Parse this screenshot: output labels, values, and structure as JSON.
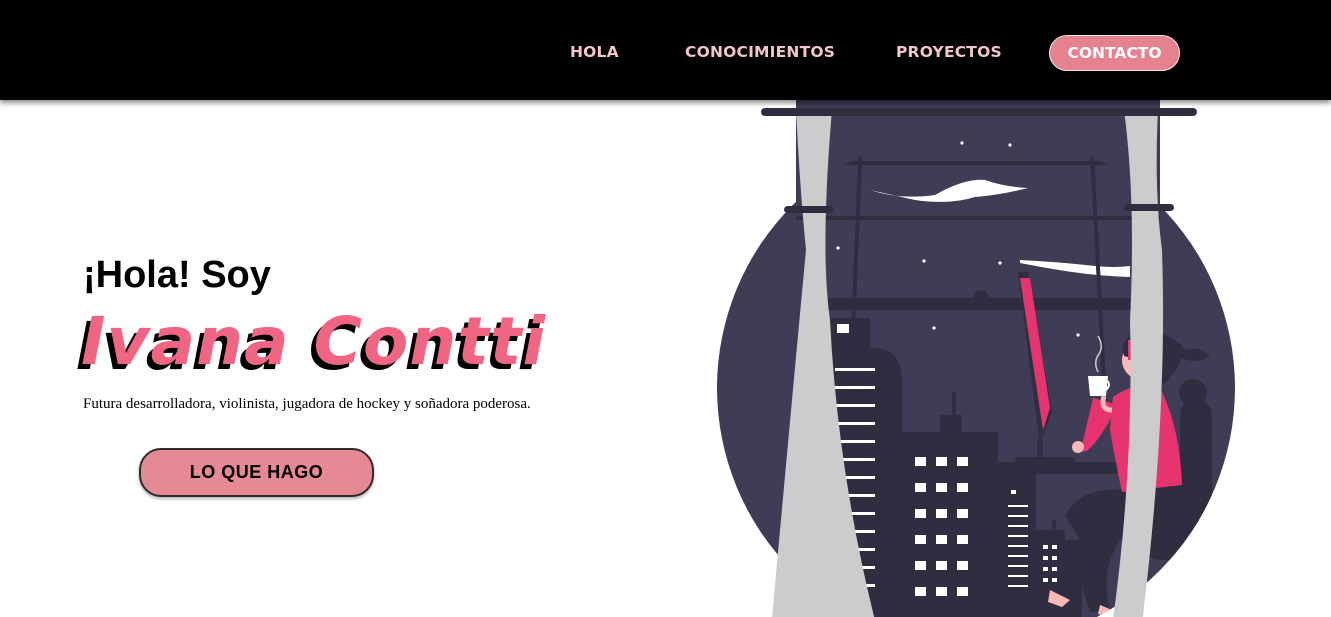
{
  "nav": {
    "items": [
      {
        "label": "HOLA"
      },
      {
        "label": "CONOCIMIENTOS"
      },
      {
        "label": "PROYECTOS"
      }
    ],
    "contact_label": "CONTACTO"
  },
  "hero": {
    "greeting": "¡Hola! Soy",
    "name": "Ivana Contti",
    "description": "Futura desarrolladora, violinista, jugadora de hockey y soñadora poderosa.",
    "button_label": "LO QUE HAGO"
  },
  "colors": {
    "nav_bg": "#000000",
    "nav_link": "#f2c4cc",
    "accent_pink": "#e58a94",
    "name_pink": "#f06582",
    "night_sky": "#3f3d56",
    "curtain": "#cccccc"
  },
  "illustration": {
    "icon": "woman-at-window-night-city-illustration"
  }
}
